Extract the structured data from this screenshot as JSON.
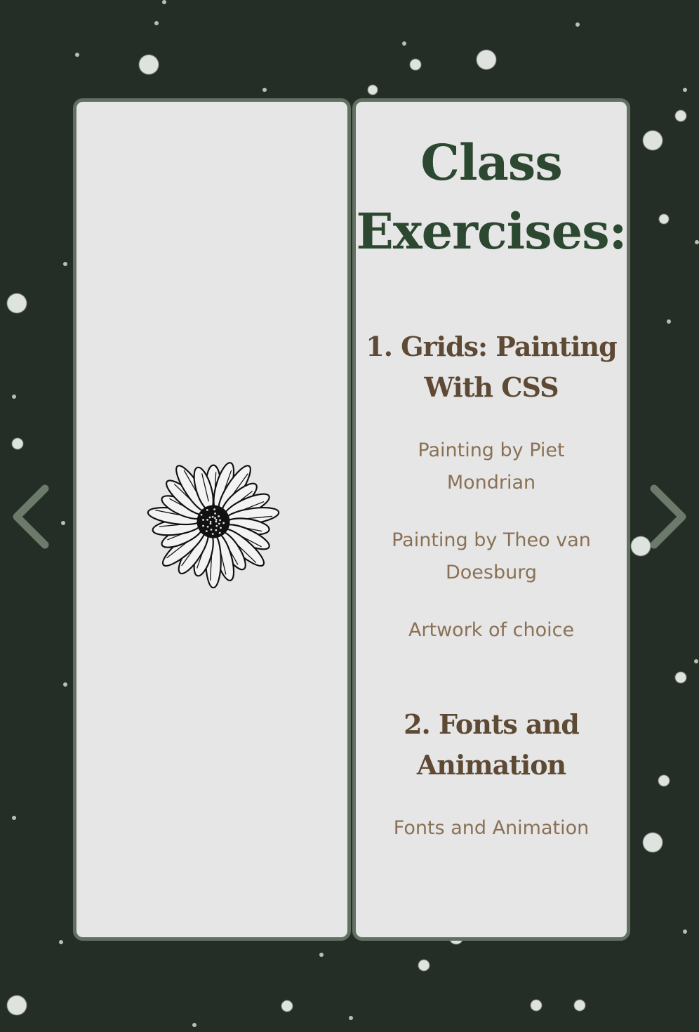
{
  "book": {
    "title": "Class Exercises:",
    "sections": [
      {
        "heading": "1. Grids: Painting With CSS",
        "items": [
          "Painting by Piet Mondrian",
          "Painting by Theo van Doesburg",
          "Artwork of choice"
        ]
      },
      {
        "heading": "2. Fonts and Animation",
        "items": [
          "Fonts and Animation"
        ]
      }
    ]
  },
  "icons": {
    "left_page_image": "daisy-flower-drawing",
    "prev": "chevron-left-icon",
    "next": "chevron-right-icon"
  },
  "colors": {
    "background": "#252e26",
    "page": "#e6e6e6",
    "page_border": "#627062",
    "title": "#2c4830",
    "section_heading": "#5e4a34",
    "item_text": "#8a7155"
  }
}
